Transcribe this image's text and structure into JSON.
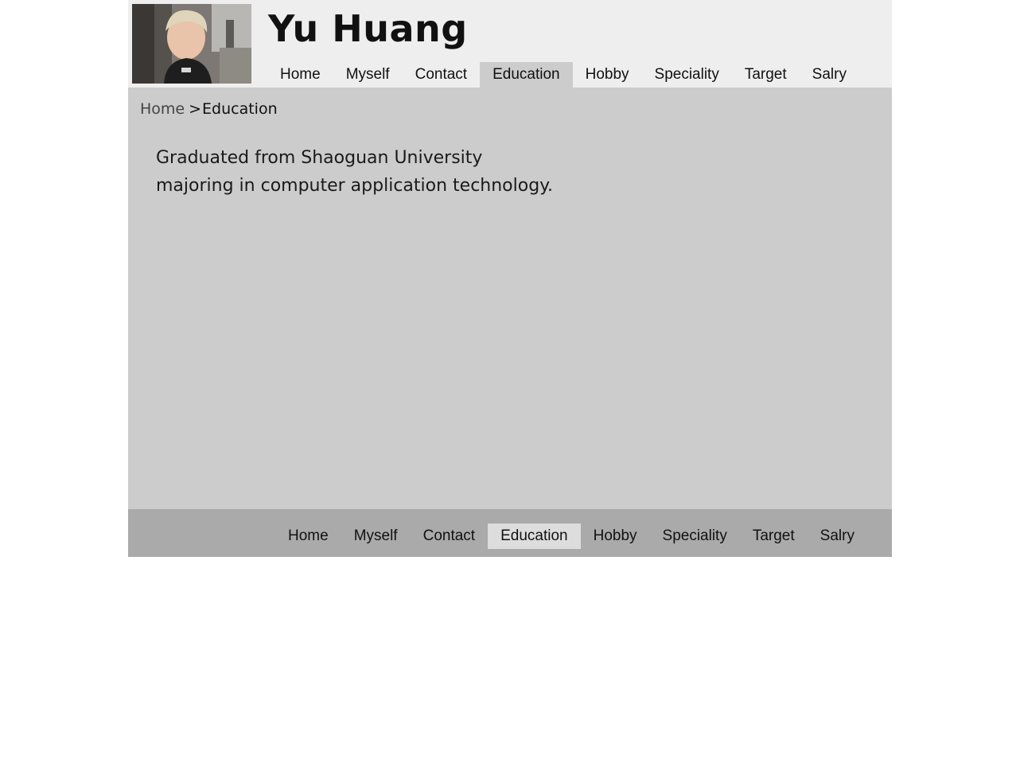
{
  "header": {
    "title": "Yu Huang",
    "avatar_alt": "profile photo"
  },
  "nav": {
    "items": [
      {
        "label": "Home"
      },
      {
        "label": "Myself"
      },
      {
        "label": "Contact"
      },
      {
        "label": "Education",
        "active": true
      },
      {
        "label": "Hobby"
      },
      {
        "label": "Speciality"
      },
      {
        "label": "Target"
      },
      {
        "label": "Salry"
      }
    ]
  },
  "breadcrumb": {
    "home": "Home",
    "separator": ">",
    "current": "Education"
  },
  "content": {
    "lines": [
      "Graduated from Shaoguan University",
      "majoring in computer application technology."
    ]
  },
  "colors": {
    "header_bg": "#eeeeee",
    "main_bg": "#cccccc",
    "footer_bg": "#aaaaaa",
    "active_tab_top": "#cccccc",
    "active_tab_bottom": "#dddddd"
  }
}
